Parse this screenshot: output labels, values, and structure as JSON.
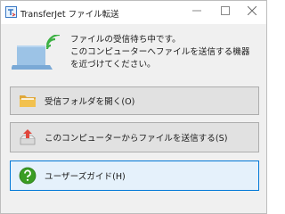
{
  "window": {
    "title": "TransferJet ファイル転送",
    "minimize_icon": "minimize-icon",
    "maximize_icon": "maximize-icon",
    "close_icon": "close-icon"
  },
  "status": {
    "lines": [
      "ファイルの受信待ち中です。",
      "このコンピューターへファイルを送信する機器",
      "を近づけてください。"
    ]
  },
  "actions": {
    "open_folder_label": "受信フォルダを開く(O)",
    "send_files_label": "このコンピューターからファイルを送信する(S)",
    "user_guide_label": "ユーザーズガイド(H)"
  },
  "colors": {
    "wireless_accent": "#3cb043",
    "folder": "#f2c14e",
    "send_arrow": "#e0473d",
    "help_icon": "#3a9d23",
    "focus_border": "#0078d7"
  }
}
